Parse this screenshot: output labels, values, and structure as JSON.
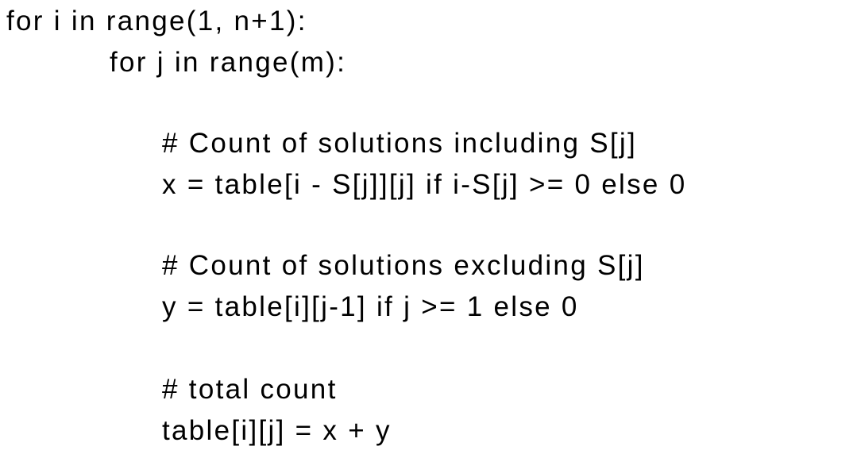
{
  "code": {
    "lines": [
      "for i in range(1, n+1):",
      "for j in range(m):",
      "# Count of solutions including S[j]",
      "x = table[i - S[j]][j] if i-S[j] >= 0 else 0",
      "# Count of solutions excluding S[j]",
      "y = table[i][j-1] if j >= 1 else 0",
      "# total count",
      "table[i][j] = x + y"
    ]
  }
}
